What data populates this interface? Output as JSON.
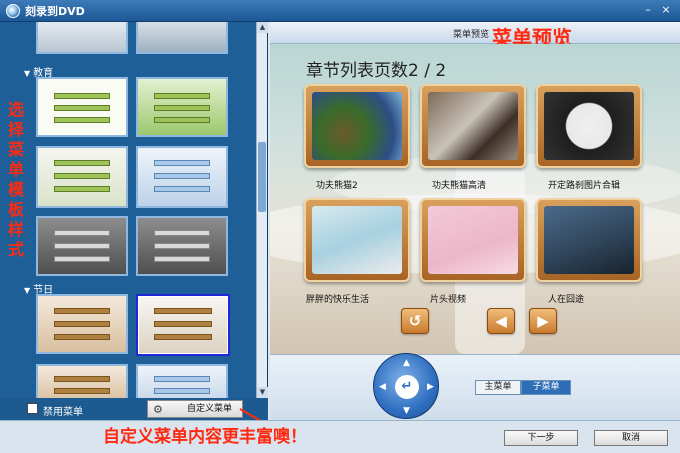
{
  "window": {
    "title": "刻录到DVD",
    "minimize_glyph": "–",
    "close_glyph": "×"
  },
  "left_panel": {
    "categories": [
      {
        "label": "教育"
      },
      {
        "label": "节日"
      }
    ],
    "annotation": "选择菜单模板样式",
    "disable_menu_label": "禁用菜单",
    "disable_menu_checked": false,
    "custom_menu_label": "自定义菜单"
  },
  "preview": {
    "header_label": "菜单预览",
    "header_annotation": "菜单预览",
    "page_title": "章节列表页数2 / 2",
    "chapters": [
      {
        "label": "功夫熊猫2"
      },
      {
        "label": "功夫熊猫高清"
      },
      {
        "label": "开定路刹图片合辑"
      },
      {
        "label": "胖胖的快乐生活"
      },
      {
        "label": "片头视频"
      },
      {
        "label": "人在囧途"
      }
    ],
    "nav": {
      "return_glyph": "↺",
      "prev_glyph": "◀",
      "next_glyph": "▶"
    }
  },
  "controls": {
    "dpad_up": "▲",
    "dpad_down": "▼",
    "dpad_left": "◀",
    "dpad_right": "▶",
    "dpad_enter": "↵",
    "main_menu_label": "主菜单",
    "sub_menu_label": "子菜单",
    "active_menu": "子菜单"
  },
  "footer": {
    "annotation": "自定义菜单内容更丰富噢！",
    "next_label": "下一步",
    "cancel_label": "取消"
  },
  "colors": {
    "annotation_red": "#ff2a10",
    "panel_blue": "#1f5f98",
    "selected_border": "#1e28d8",
    "chapter_frame": "#c87a2c"
  }
}
